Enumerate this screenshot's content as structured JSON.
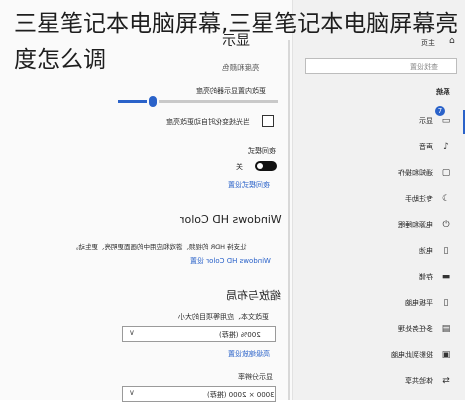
{
  "overlay": {
    "title": "三星笔记本电脑屏幕,三星笔记本电脑屏幕亮度怎么调"
  },
  "settings": {
    "page_title": "显示",
    "brightness_section": "亮度和颜色",
    "brightness_label": "更改内置显示器的亮度",
    "auto_brightness_label": "当光线变化时自动更改亮度",
    "night_light_label": "夜间模式",
    "night_light_state": "关",
    "night_light_settings_link": "夜间模式设置",
    "hdr_heading": "Windows HD Color",
    "hdr_desc_line1": "让支持 HDR 的视频、游戏和应用中的画面更明亮、更生动。",
    "hdr_settings_link": "Windows HD Color 设置",
    "scale_heading": "缩放与布局",
    "scale_label": "更改文本、应用等项目的大小",
    "scale_value": "200% (推荐)",
    "advanced_scale_link": "高级缩放设置",
    "resolution_label": "显示分辨率",
    "resolution_value": "3000 × 2000 (推荐)"
  },
  "sidebar": {
    "home": "主页",
    "search_placeholder": "查找设置",
    "group_title": "系统",
    "badge": "7",
    "items": [
      {
        "label": "显示",
        "icon": "monitor-icon"
      },
      {
        "label": "声音",
        "icon": "speaker-icon"
      },
      {
        "label": "通知和操作",
        "icon": "notification-icon"
      },
      {
        "label": "专注助手",
        "icon": "moon-icon"
      },
      {
        "label": "电源和睡眠",
        "icon": "power-icon"
      },
      {
        "label": "电池",
        "icon": "battery-icon"
      },
      {
        "label": "存储",
        "icon": "storage-icon"
      },
      {
        "label": "平板电脑",
        "icon": "tablet-icon"
      },
      {
        "label": "多任务处理",
        "icon": "multitask-icon"
      },
      {
        "label": "投影到此电脑",
        "icon": "projector-icon"
      },
      {
        "label": "体验共享",
        "icon": "share-icon"
      }
    ]
  },
  "colors": {
    "accent": "#2a62c9",
    "sidebar_bg": "#f1f1f1",
    "main_bg": "#fafafa"
  }
}
